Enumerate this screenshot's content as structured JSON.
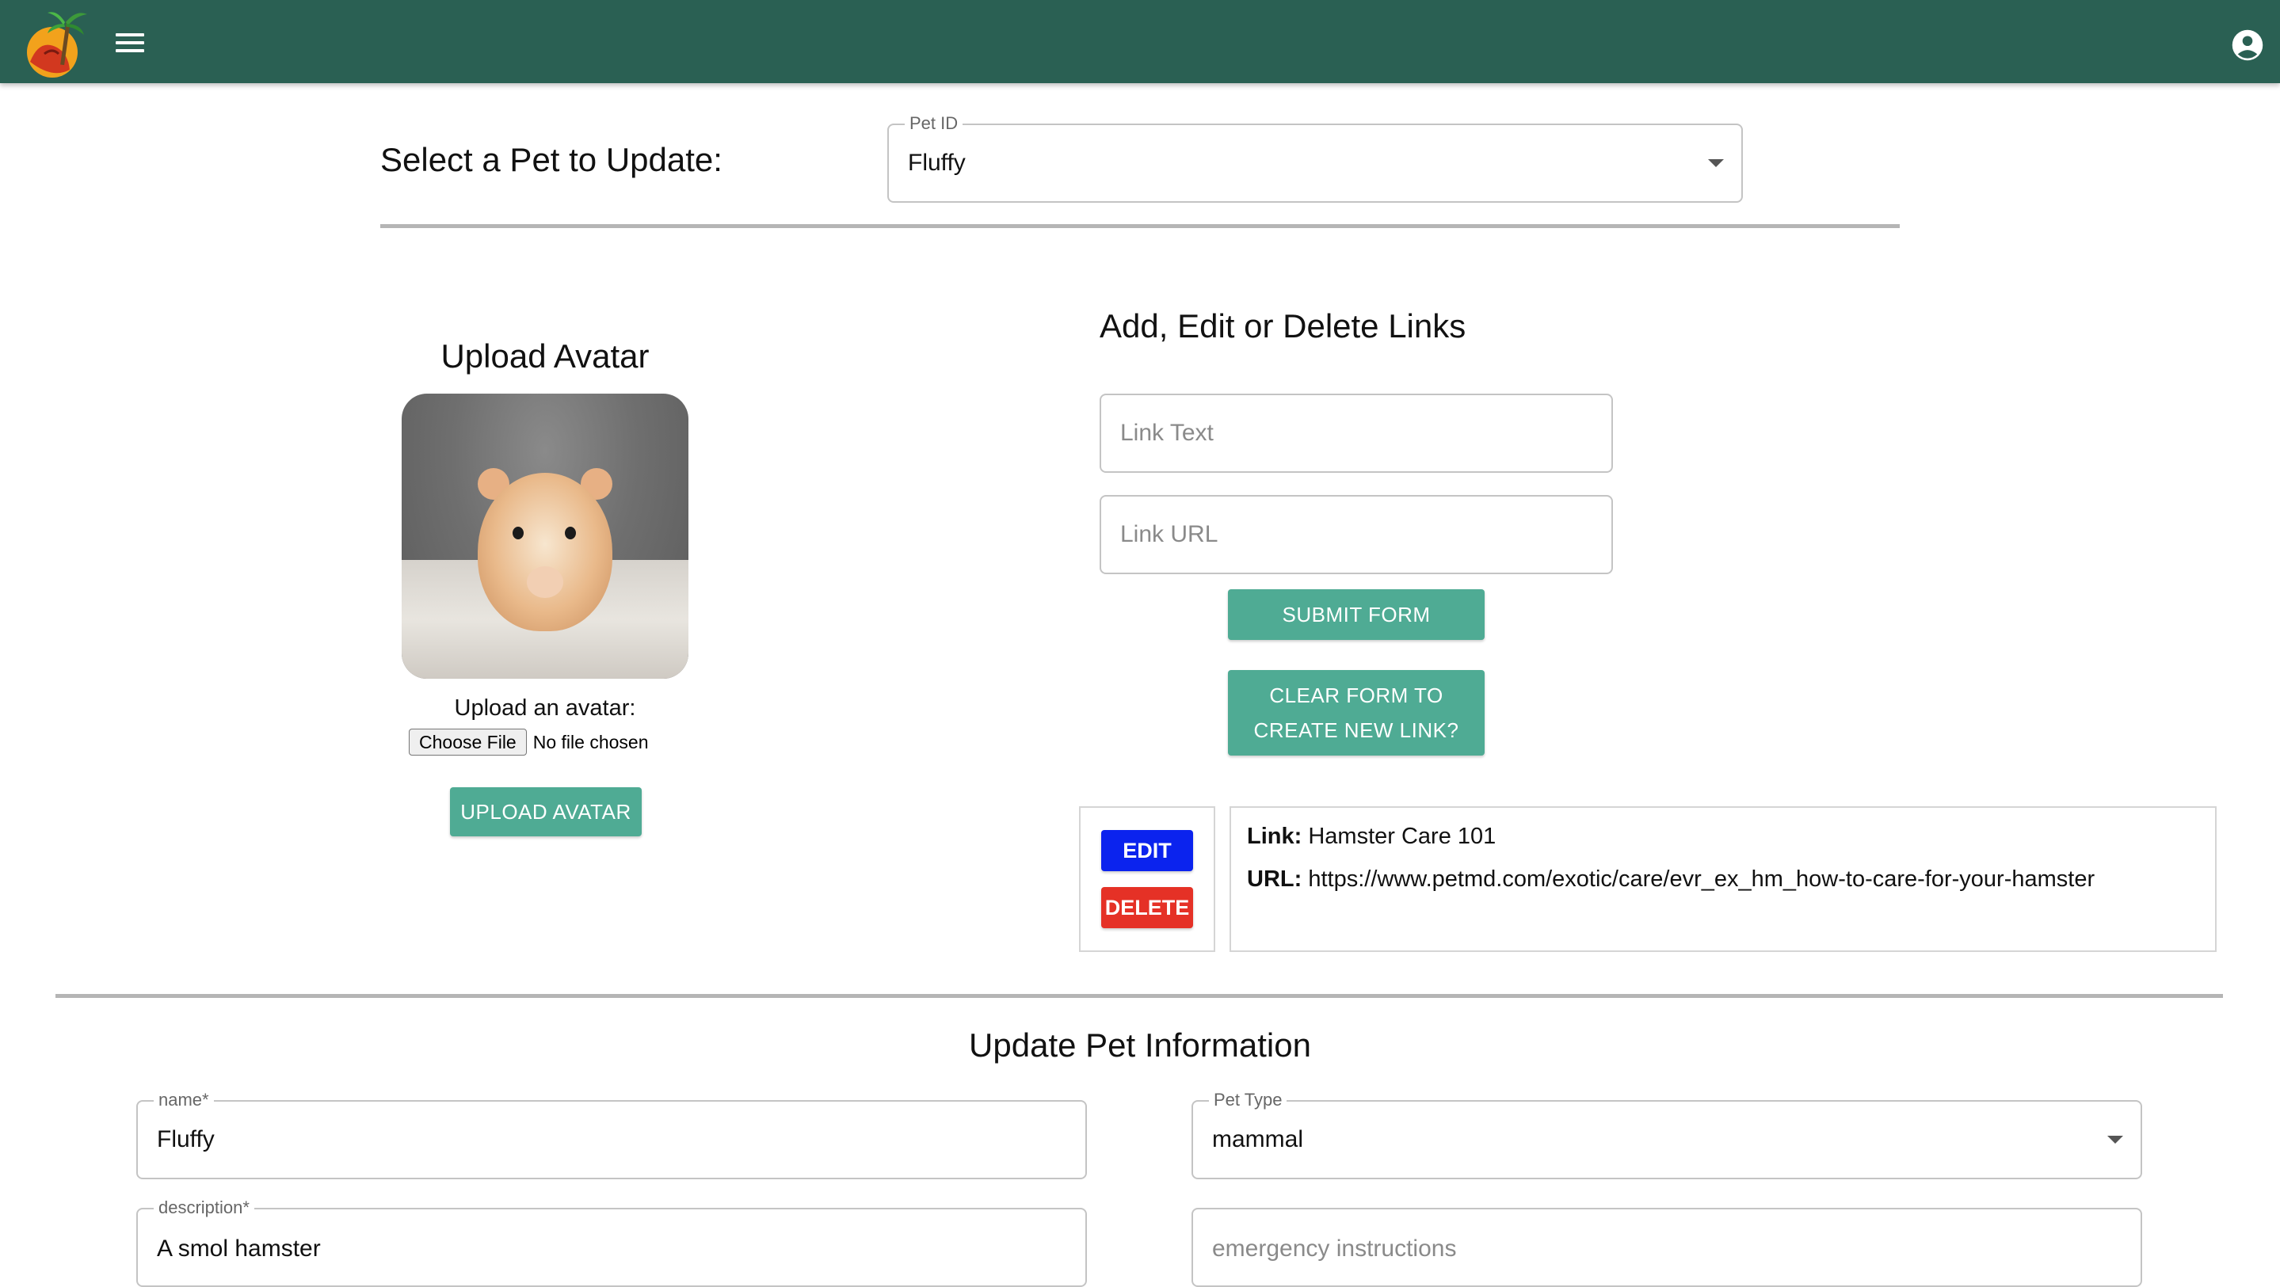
{
  "appbar": {
    "logo_icon": "palm-tree-logo-icon",
    "menu_icon": "hamburger-menu-icon",
    "account_icon": "account-circle-icon",
    "color": "#2a6053"
  },
  "select_pet": {
    "heading": "Select a Pet to Update:",
    "field_label": "Pet ID",
    "value": "Fluffy"
  },
  "avatar": {
    "heading": "Upload Avatar",
    "upload_label": "Upload an avatar:",
    "choose_file": "Choose File",
    "file_status": "No file chosen",
    "upload_button": "UPLOAD AVATAR"
  },
  "links": {
    "heading": "Add, Edit or Delete Links",
    "link_text_placeholder": "Link Text",
    "link_url_placeholder": "Link URL",
    "submit_button": "SUBMIT FORM",
    "clear_button_line1": "CLEAR FORM TO",
    "clear_button_line2": "CREATE NEW LINK?",
    "items": [
      {
        "edit_label": "EDIT",
        "delete_label": "DELETE",
        "link_label": "Link:",
        "link_value": "Hamster Care 101",
        "url_label": "URL:",
        "url_value": "https://www.petmd.com/exotic/care/evr_ex_hm_how-to-care-for-your-hamster"
      }
    ]
  },
  "update_info": {
    "heading": "Update Pet Information",
    "name_label": "name",
    "name_value": "Fluffy",
    "pet_type_label": "Pet Type",
    "pet_type_value": "mammal",
    "description_label": "description",
    "description_value": "A smol hamster",
    "emergency_placeholder": "emergency instructions",
    "required_mark": "*"
  },
  "colors": {
    "teal_button": "#4fab94",
    "edit_button": "#0b23ee",
    "delete_button": "#e53126"
  }
}
